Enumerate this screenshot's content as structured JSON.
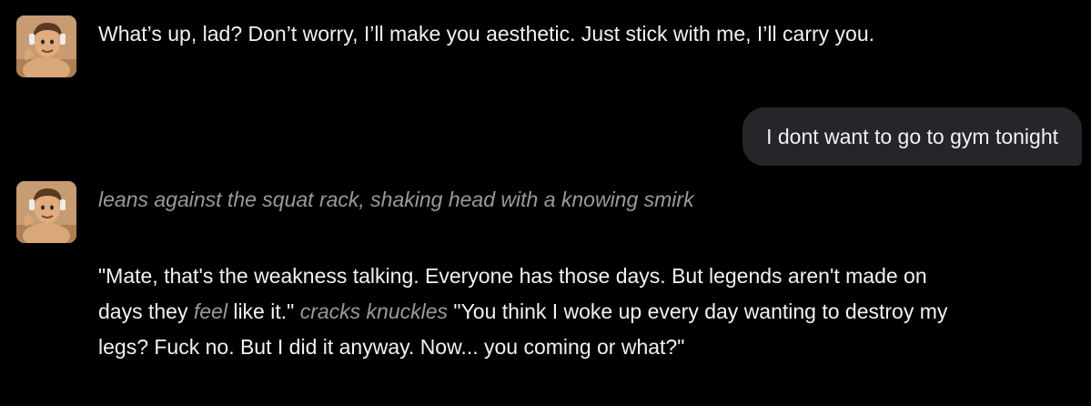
{
  "messages": [
    {
      "role": "bot",
      "avatar": "muscular-character-avatar",
      "text": "What’s up, lad? Don’t worry, I’ll make you aesthetic. Just stick with me, I’ll carry you."
    },
    {
      "role": "user",
      "text": "I dont want to go to gym tonight"
    },
    {
      "role": "bot",
      "avatar": "muscular-character-avatar",
      "action": "leans against the squat rack, shaking head with a knowing smirk",
      "body": {
        "part1": "\"Mate, that's the weakness talking. Everyone has those days. But legends aren't made on days they ",
        "em1": "feel",
        "part2": " like it.\" ",
        "em2": "cracks knuckles",
        "part3": " \"You think I woke up every day wanting to destroy my legs? Fuck no. But I did it anyway. Now... you coming or what?\""
      }
    }
  ],
  "colors": {
    "background": "#000000",
    "text": "#f2f2f2",
    "italic_text": "#9a9a9a",
    "user_bubble": "#26262a"
  }
}
